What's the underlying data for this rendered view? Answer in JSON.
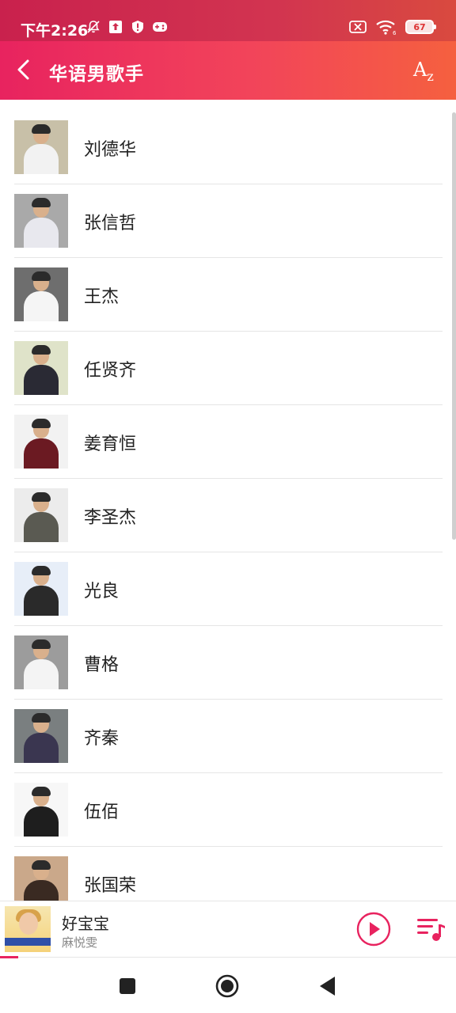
{
  "status_bar": {
    "time": "下午2:26",
    "battery": "67",
    "left_icons": [
      "mute-icon",
      "upload-icon",
      "shield-alert-icon",
      "gamepad-icon"
    ],
    "right_icons": [
      "sim-error-icon",
      "wifi-icon",
      "battery-icon"
    ]
  },
  "app_bar": {
    "title": "华语男歌手",
    "sort_label": "A",
    "sort_sub": "z"
  },
  "artists": [
    {
      "name": "刘德华",
      "bg": "#c8c0a8",
      "outfit": "#f2f2f2"
    },
    {
      "name": "张信哲",
      "bg": "#a9a9a9",
      "outfit": "#e8e8ee"
    },
    {
      "name": "王杰",
      "bg": "#6e6e6e",
      "outfit": "#f5f5f5"
    },
    {
      "name": "任贤齐",
      "bg": "#dfe3c9",
      "outfit": "#2a2a34"
    },
    {
      "name": "姜育恒",
      "bg": "#f2f2f2",
      "outfit": "#6b1a22"
    },
    {
      "name": "李圣杰",
      "bg": "#ececec",
      "outfit": "#5a5a52"
    },
    {
      "name": "光良",
      "bg": "#e7eef8",
      "outfit": "#2a2a2a"
    },
    {
      "name": "曹格",
      "bg": "#9c9c9c",
      "outfit": "#f4f4f4"
    },
    {
      "name": "齐秦",
      "bg": "#7a7f80",
      "outfit": "#3a3650"
    },
    {
      "name": "伍佰",
      "bg": "#f7f7f7",
      "outfit": "#1e1e1e"
    },
    {
      "name": "张国荣",
      "bg": "#caa88a",
      "outfit": "#3a2a22"
    }
  ],
  "player": {
    "song": "好宝宝",
    "artist": "麻悦雯",
    "progress": 0.04,
    "accent": "#e8235f"
  },
  "nav": {
    "icons": [
      "recents-square-icon",
      "home-circle-icon",
      "back-triangle-icon"
    ]
  }
}
